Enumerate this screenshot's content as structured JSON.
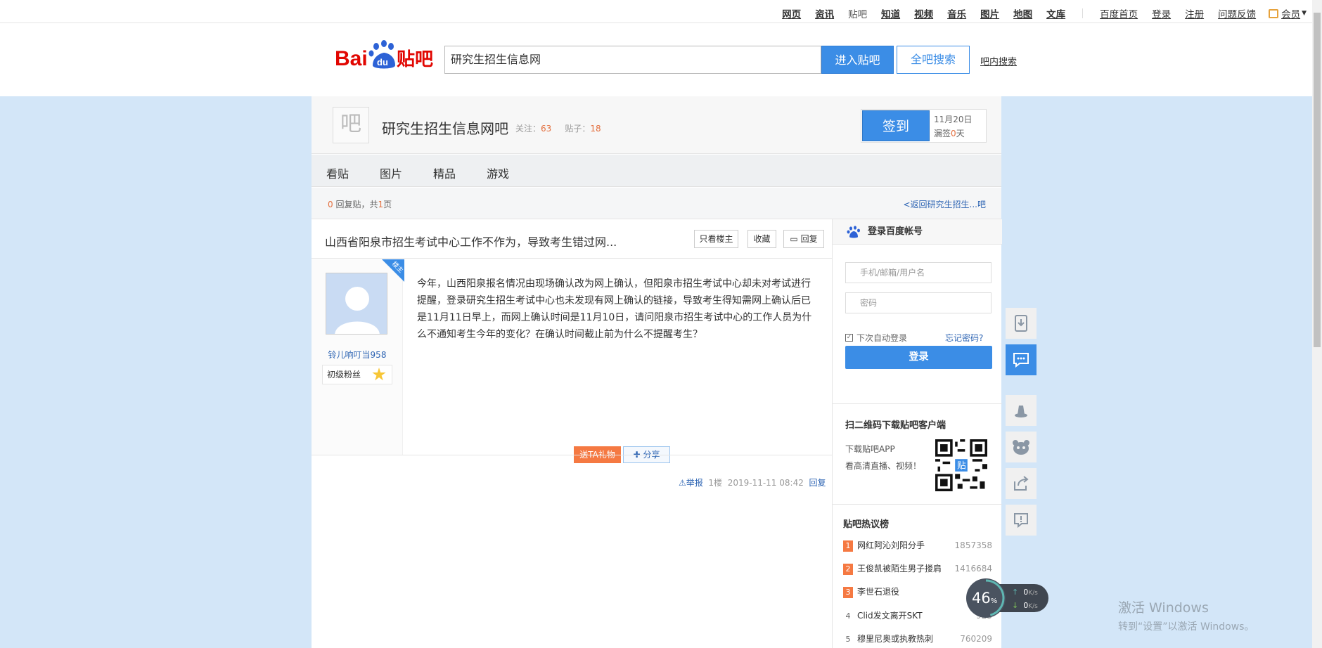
{
  "topnav": {
    "links": [
      "网页",
      "资讯",
      "贴吧",
      "知道",
      "视频",
      "音乐",
      "图片",
      "地图",
      "文库"
    ],
    "secondary": [
      "百度首页",
      "登录",
      "注册",
      "问题反馈"
    ],
    "vip": "会员"
  },
  "header": {
    "logo_text": "Bai 贴吧",
    "logo_du": "du",
    "search_value": "研究生招生信息网",
    "enter_label": "进入贴吧",
    "all_label": "全吧搜索",
    "in_bar_label": "吧内搜索"
  },
  "forum": {
    "avatar_char": "吧",
    "name": "研究生招生信息网吧",
    "follow_label": "关注：",
    "follow_count": "63",
    "posts_label": "贴子：",
    "posts_count": "18",
    "sign_label": "签到",
    "sign_date": "11月20日",
    "sign_missed_pre": "漏签",
    "sign_missed_num": "0",
    "sign_missed_post": "天"
  },
  "tabs": [
    "看贴",
    "图片",
    "精品",
    "游戏"
  ],
  "thread_bar": {
    "reply_num": "0",
    "reply_text": "回复贴，共",
    "page_num": "1",
    "page_text": "页",
    "back_link": "<返回研究生招生...吧"
  },
  "post": {
    "title": "山西省阳泉市招生考试中心工作不作为，导致考生错过网...",
    "only_op": "只看楼主",
    "collect": "收藏",
    "reply": "回复",
    "author": "铃儿响叮当958",
    "fan_level": "初级粉丝",
    "louzhu": "楼主",
    "content": "今年，山西阳泉报名情况由现场确认改为网上确认，但阳泉市招生考试中心却未对考试进行提醒，登录研究生招生考试中心也未发现有网上确认的链接，导致考生得知需网上确认后已是11月11日早上，而网上确认时间是11月10日，请问阳泉市招生考试中心的工作人员为什么不通知考生今年的变化？在确认时间截止前为什么不提醒考生？",
    "gift": "送TA礼物",
    "share": "分享",
    "report": "举报",
    "floor": "1楼",
    "time": "2019-11-11 08:42",
    "reply_link": "回复"
  },
  "sidebar": {
    "login_title": "登录百度帐号",
    "username_placeholder": "手机/邮箱/用户名",
    "password_placeholder": "密码",
    "remember": "下次自动登录",
    "forgot": "忘记密码?",
    "login_button": "登录",
    "qr_title": "扫二维码下载贴吧客户端",
    "qr_line1": "下载贴吧APP",
    "qr_line2": "看高清直播、视频！",
    "hot_title": "贴吧热议榜",
    "hot": [
      {
        "rank": "1",
        "name": "网红阿沁刘阳分手",
        "count": "1857358"
      },
      {
        "rank": "2",
        "name": "王俊凯被陌生男子搂肩",
        "count": "1416684"
      },
      {
        "rank": "3",
        "name": "李世石退役",
        "count": "126"
      },
      {
        "rank": "4",
        "name": "Clid发文离开SKT",
        "count": "923"
      },
      {
        "rank": "5",
        "name": "穆里尼奥或执教热刺",
        "count": "760209"
      }
    ]
  },
  "speed": {
    "percent": "46",
    "unit": "%",
    "up": "0",
    "down": "0",
    "rate_unit": "K/s"
  },
  "watermark": {
    "line1": "激活 Windows",
    "line2": "转到“设置”以激活 Windows。"
  }
}
